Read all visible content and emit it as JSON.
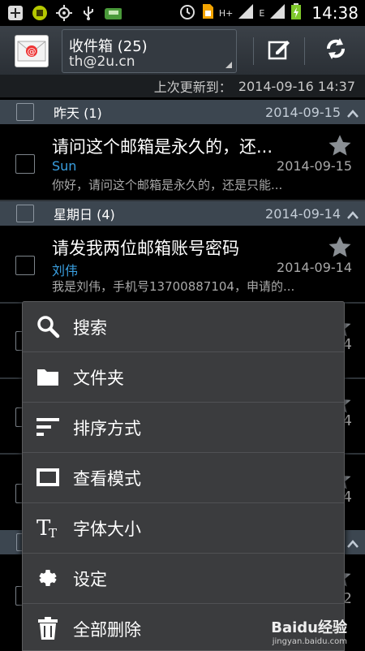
{
  "status_bar": {
    "time": "14:38",
    "network_h_label": "H+",
    "network_e_label": "E",
    "left_icons": [
      "add-icon",
      "android-debug-icon",
      "gps-icon",
      "usb-icon",
      "car-icon"
    ],
    "right_icons": [
      "alarm-icon",
      "sim-icon",
      "signal-icon",
      "signal-icon",
      "battery-charging-icon"
    ]
  },
  "action_bar": {
    "app_icon": "email-app-icon",
    "folder_name": "收件箱 (25)",
    "account": "th@2u.cn",
    "compose_icon": "compose-icon",
    "refresh_icon": "refresh-icon"
  },
  "last_updated": {
    "label": "上次更新到：",
    "value": "2014-09-16 14:37"
  },
  "groups": [
    {
      "label": "昨天 (1)",
      "date": "2014-09-15",
      "items": [
        {
          "subject": "请问这个邮箱是永久的，还...",
          "sender": "Sun",
          "date": "2014-09-15",
          "preview": "你好，请问这个邮箱是永久的，还是只能..."
        }
      ]
    },
    {
      "label": "星期日 (4)",
      "date": "2014-09-14",
      "items": [
        {
          "subject": "请发我两位邮箱账号密码",
          "sender": "刘伟",
          "date": "2014-09-14",
          "preview": "我是刘伟，手机号13700887104，申请的..."
        }
      ]
    }
  ],
  "peek": {
    "digits": [
      "4",
      "4",
      "4",
      "2"
    ]
  },
  "menu": {
    "items": [
      {
        "label": "搜索",
        "icon": "search-icon"
      },
      {
        "label": "文件夹",
        "icon": "folder-icon"
      },
      {
        "label": "排序方式",
        "icon": "sort-icon"
      },
      {
        "label": "查看模式",
        "icon": "view-mode-icon"
      },
      {
        "label": "字体大小",
        "icon": "font-size-icon"
      },
      {
        "label": "设定",
        "icon": "settings-gear-icon"
      },
      {
        "label": "全部删除",
        "icon": "trash-icon"
      }
    ]
  },
  "watermark": {
    "logo": "Baidu经验",
    "url": "jingyan.baidu.com"
  },
  "colors": {
    "sender_link": "#3a9fe0",
    "group_header_bg": "#3c4650",
    "menu_bg": "#3b3c3e"
  }
}
